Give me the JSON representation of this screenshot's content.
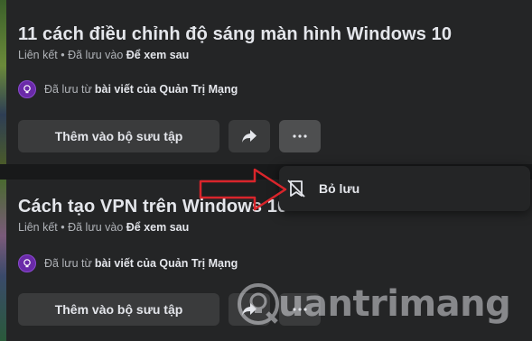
{
  "posts": [
    {
      "title": "11 cách điều chỉnh độ sáng màn hình Windows 10",
      "meta_prefix": "Liên kết • Đã lưu vào ",
      "meta_collection": "Để xem sau",
      "source_prefix": "Đã lưu từ",
      "source_name": "bài viết của Quản Trị Mạng",
      "add_label": "Thêm vào bộ sưu tập"
    },
    {
      "title": "Cách tạo VPN trên Windows 10",
      "meta_prefix": "Liên kết • Đã lưu vào ",
      "meta_collection": "Để xem sau",
      "source_prefix": "Đã lưu từ",
      "source_name": "bài viết của Quản Trị Mạng",
      "add_label": "Thêm vào bộ sưu tập"
    }
  ],
  "menu": {
    "unsave_label": "Bỏ lưu",
    "unsave_icon": "unsave-bookmark-icon"
  },
  "watermark": {
    "text": "uantrimang"
  },
  "colors": {
    "background": "#18191a",
    "card": "#242526",
    "button": "#3a3b3c",
    "text_primary": "#e4e6eb",
    "text_secondary": "#b0b3b8",
    "arrow": "#d9252b",
    "avatar": "#6a2aa8"
  }
}
